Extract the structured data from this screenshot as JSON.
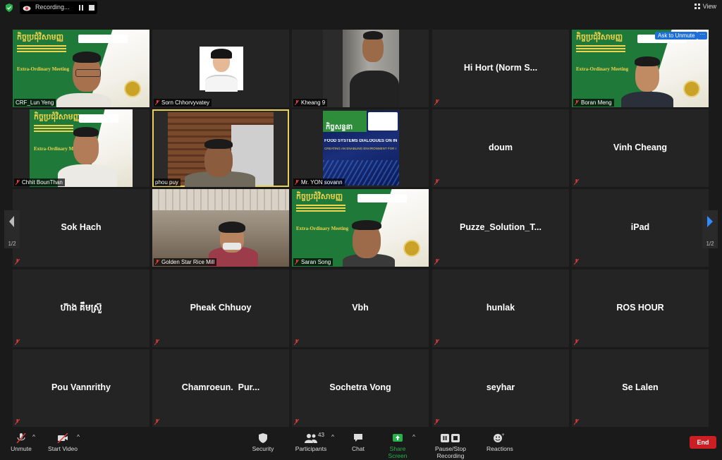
{
  "topbar": {
    "recording_label": "Recording...",
    "view_label": "View"
  },
  "tiles": [
    {
      "name": "CRF_Lun Yeng"
    },
    {
      "name": "Sorn Chhorvyvatey"
    },
    {
      "name": "Kheang 9"
    },
    {
      "name": "Hi Hort (Norm S..."
    },
    {
      "name": "Boran Meng"
    },
    {
      "name": "Chhit BounThan"
    },
    {
      "name": "phou puy"
    },
    {
      "name": "Mr. YON sovann"
    },
    {
      "name": "doum"
    },
    {
      "name": "Vinh Cheang"
    },
    {
      "name": "Sok Hach"
    },
    {
      "name": "Golden Star Rice Mill"
    },
    {
      "name": "Saran Song"
    },
    {
      "name": "Puzze_Solution_T..."
    },
    {
      "name": "iPad"
    },
    {
      "name": "ហ៊ាង គឹមស្រ៊ួ"
    },
    {
      "name": "Pheak Chhuoy"
    },
    {
      "name": "Vbh"
    },
    {
      "name": "hunlak"
    },
    {
      "name": "ROS HOUR"
    },
    {
      "name": "Pou Vannrithy"
    },
    {
      "name": "Chamroeun.  Pur..."
    },
    {
      "name": "Sochetra Vong"
    },
    {
      "name": "seyhar"
    },
    {
      "name": "Se Lalen"
    }
  ],
  "poster": {
    "khmer_title": "កិច្ចប្រជុំវិសាមញ្ញ",
    "subtitle": "Extra-Ordinary Meeting"
  },
  "foodsystems": {
    "title": "FOOD SYSTEMS DIALOGUES ON IN",
    "subtitle": "CREATING  AN ENABLING ENVIRONMENT FOR I",
    "khmer": "កិច្ចសន្ទនា"
  },
  "ask_to_unmute": "Ask to Unmute",
  "pagination": {
    "left": "1/2",
    "right": "1/2"
  },
  "toolbar": {
    "unmute": "Unmute",
    "start_video": "Start Video",
    "security": "Security",
    "participants": "Participants",
    "participants_count": "43",
    "chat": "Chat",
    "share_screen": "Share Screen",
    "pause_recording": "Pause/Stop Recording",
    "reactions": "Reactions",
    "end": "End"
  },
  "colors": {
    "share_green": "#25b34a",
    "end_red": "#cc1f24",
    "active_border": "#e6d25a",
    "ask_blue": "#1e6fd9"
  }
}
